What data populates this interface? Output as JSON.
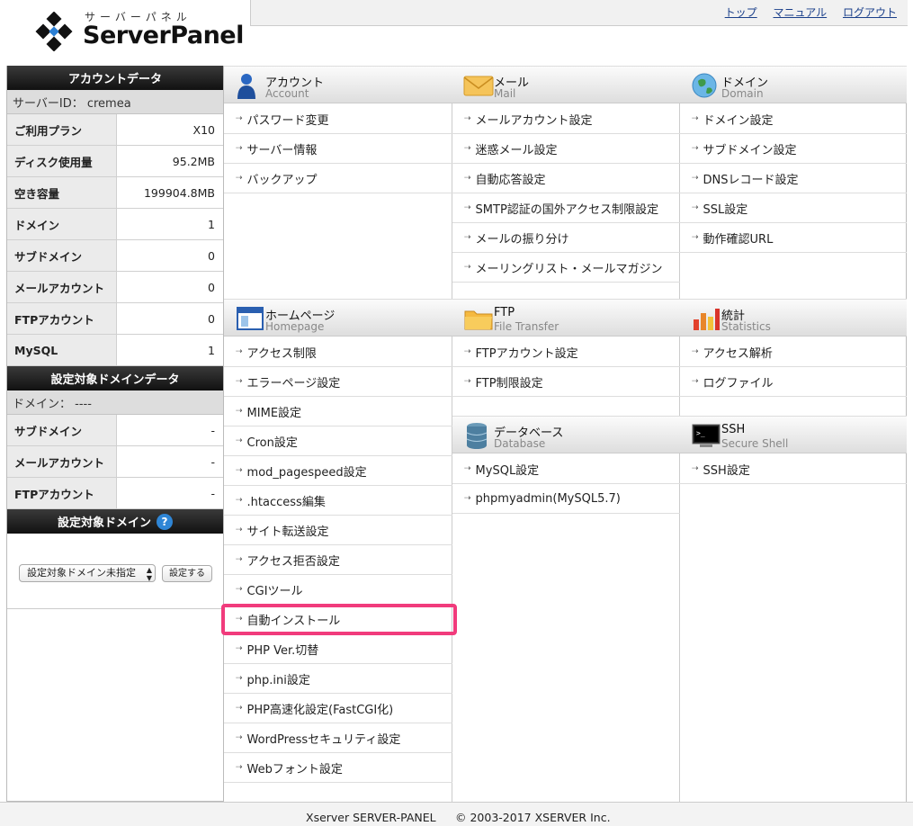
{
  "logo": {
    "kana": "サーバーパネル",
    "brand": "ServerPanel"
  },
  "topnav": {
    "top": "トップ",
    "manual": "マニュアル",
    "logout": "ログアウト"
  },
  "account_data": {
    "heading": "アカウントデータ",
    "server_id": "サーバーID： cremea",
    "rows": [
      {
        "label": "ご利用プラン",
        "value": "X10"
      },
      {
        "label": "ディスク使用量",
        "value": "95.2MB"
      },
      {
        "label": "空き容量",
        "value": "199904.8MB"
      },
      {
        "label": "ドメイン",
        "value": "1"
      },
      {
        "label": "サブドメイン",
        "value": "0"
      },
      {
        "label": "メールアカウント",
        "value": "0"
      },
      {
        "label": "FTPアカウント",
        "value": "0"
      },
      {
        "label": "MySQL",
        "value": "1"
      }
    ]
  },
  "domain_data": {
    "heading": "設定対象ドメインデータ",
    "domain": "ドメイン： ----",
    "rows": [
      {
        "label": "サブドメイン",
        "value": "-"
      },
      {
        "label": "メールアカウント",
        "value": "-"
      },
      {
        "label": "FTPアカウント",
        "value": "-"
      }
    ]
  },
  "domain_select": {
    "heading": "設定対象ドメイン",
    "help_icon": "?",
    "selected": "設定対象ドメイン未指定",
    "button": "設定する"
  },
  "sections": {
    "account": {
      "jp": "アカウント",
      "en": "Account",
      "items": [
        "パスワード変更",
        "サーバー情報",
        "バックアップ"
      ]
    },
    "mail": {
      "jp": "メール",
      "en": "Mail",
      "items": [
        "メールアカウント設定",
        "迷惑メール設定",
        "自動応答設定",
        "SMTP認証の国外アクセス制限設定",
        "メールの振り分け",
        "メーリングリスト・メールマガジン"
      ]
    },
    "domain": {
      "jp": "ドメイン",
      "en": "Domain",
      "items": [
        "ドメイン設定",
        "サブドメイン設定",
        "DNSレコード設定",
        "SSL設定",
        "動作確認URL"
      ]
    },
    "homepage": {
      "jp": "ホームページ",
      "en": "Homepage",
      "items": [
        "アクセス制限",
        "エラーページ設定",
        "MIME設定",
        "Cron設定",
        "mod_pagespeed設定",
        ".htaccess編集",
        "サイト転送設定",
        "アクセス拒否設定",
        "CGIツール",
        "自動インストール",
        "PHP Ver.切替",
        "php.ini設定",
        "PHP高速化設定(FastCGI化)",
        "WordPressセキュリティ設定",
        "Webフォント設定"
      ]
    },
    "ftp": {
      "jp": "FTP",
      "en": "File Transfer",
      "items": [
        "FTPアカウント設定",
        "FTP制限設定"
      ]
    },
    "stats": {
      "jp": "統計",
      "en": "Statistics",
      "items": [
        "アクセス解析",
        "ログファイル"
      ]
    },
    "database": {
      "jp": "データベース",
      "en": "Database",
      "items": [
        "MySQL設定",
        "phpmyadmin(MySQL5.7)"
      ]
    },
    "ssh": {
      "jp": "SSH",
      "en": "Secure Shell",
      "items": [
        "SSH設定"
      ]
    }
  },
  "highlighted_item": "自動インストール",
  "highlight_color": "#f13b7c",
  "footer": {
    "product": "Xserver SERVER-PANEL",
    "copyright": "© 2003-2017 XSERVER Inc."
  }
}
